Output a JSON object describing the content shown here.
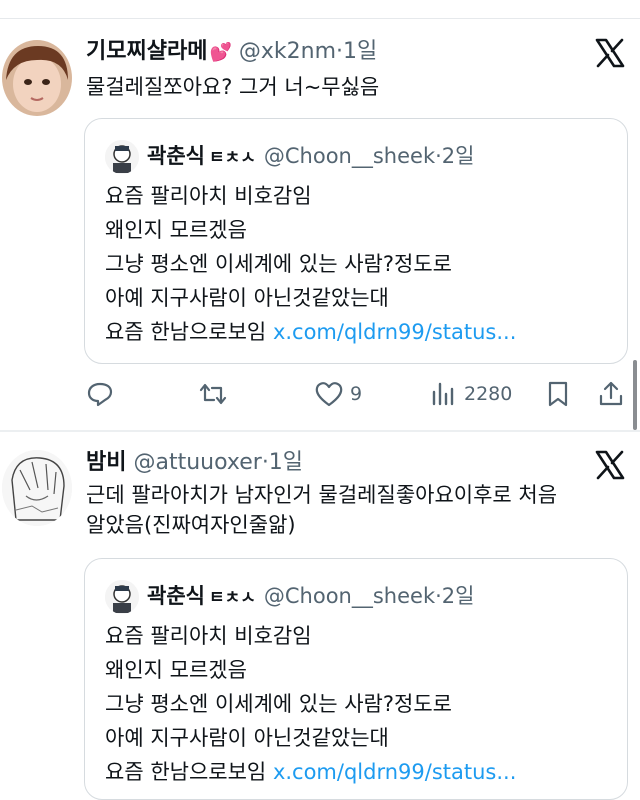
{
  "posts": [
    {
      "author": {
        "name": "기모찌샬라메",
        "emoji": "💕",
        "handle": "@xk2nm",
        "time": "·1일"
      },
      "text": "물걸레질쪼아요? 그거 너~무싫음",
      "quote": {
        "author": {
          "name": "곽춘식",
          "suffix": "ㅌㅊㅅ",
          "handle": "@Choon__sheek",
          "time": "·2일"
        },
        "lines": [
          "요즘 팔리아치 비호감임",
          "왜인지 모르겠음",
          "그냥 평소엔 이세계에 있는 사람?정도로",
          "아예 지구사람이 아닌것같았는대"
        ],
        "last_line": "요즘 한남으로보임",
        "link": "x.com/qldrn99/status..."
      },
      "actions": {
        "reply_icon": "reply-icon",
        "retweet_icon": "retweet-icon",
        "likes": "9",
        "views": "2280"
      }
    },
    {
      "author": {
        "name": "밤비",
        "handle": "@attuuoxer",
        "time": "·1일"
      },
      "text_lines": [
        "근데 팔라아치가 남자인거 물걸레질좋아요이후로 처음",
        "알았음(진짜여자인줄앎)"
      ],
      "quote": {
        "author": {
          "name": "곽춘식",
          "suffix": "ㅌㅊㅅ",
          "handle": "@Choon__sheek",
          "time": "·2일"
        },
        "lines": [
          "요즘 팔리아치 비호감임",
          "왜인지 모르겠음",
          "그냥 평소엔 이세계에 있는 사람?정도로",
          "아예 지구사람이 아닌것같았는대"
        ],
        "last_line": "요즘 한남으로보임",
        "link": "x.com/qldrn99/status..."
      }
    }
  ],
  "colors": {
    "link": "#1d9bf0",
    "muted": "#536471",
    "text": "#0f1419",
    "border": "#d6dbdf"
  }
}
